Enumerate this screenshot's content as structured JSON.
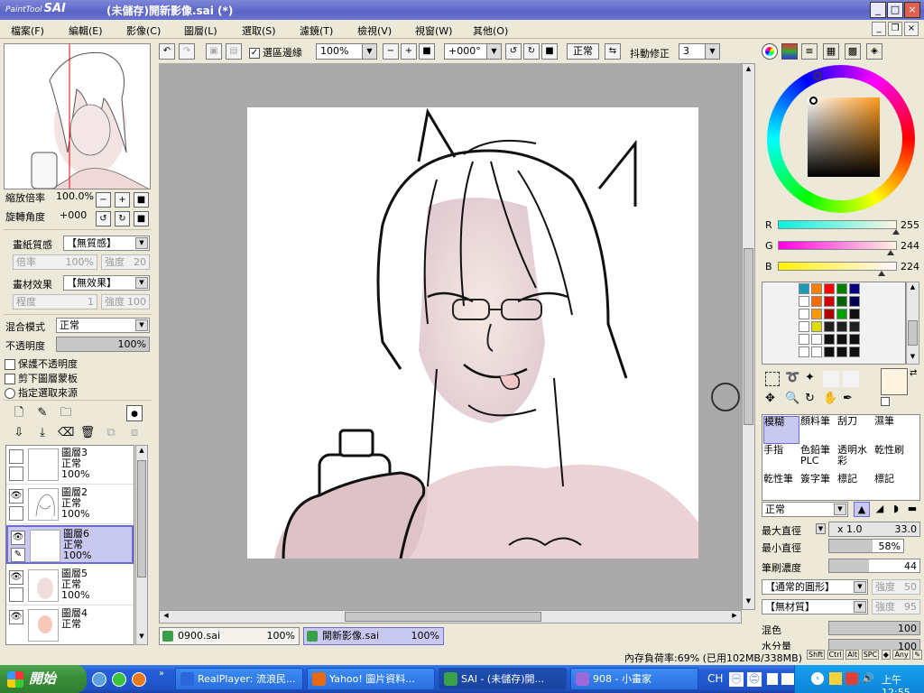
{
  "window": {
    "app_logo_small": "PaintTool",
    "app_logo_big": "SAI",
    "title": "(未儲存)開新影像.sai (*)",
    "min": "_",
    "max": "□",
    "close": "×"
  },
  "menu": [
    "檔案(F)",
    "編輯(E)",
    "影像(C)",
    "圖層(L)",
    "選取(S)",
    "濾鏡(T)",
    "檢視(V)",
    "視窗(W)",
    "其他(O)"
  ],
  "toolbar": {
    "show_selection_label": "選區邊緣",
    "show_selection_checked": true,
    "zoom": "100%",
    "rotation": "+000°",
    "blend_mode": "正常",
    "stabilizer_label": "抖動修正",
    "stabilizer_value": "3"
  },
  "navigator": {
    "zoom_label": "縮放倍率",
    "zoom_value": "100.0%",
    "rotate_label": "旋轉角度",
    "rotate_value": "+000"
  },
  "texture": {
    "paper_label": "畫紙質感",
    "paper_value": "【無質感】",
    "scale_label": "倍率",
    "scale_value": "100%",
    "strength_label": "強度",
    "strength_value": "20",
    "effect_label": "畫材效果",
    "effect_value": "【無效果】",
    "degree_label": "程度",
    "degree_value": "1",
    "effect_strength_label": "強度",
    "effect_strength_value": "100"
  },
  "layer_props": {
    "mode_label": "混合模式",
    "mode_value": "正常",
    "opacity_label": "不透明度",
    "opacity_value": "100%",
    "opacity": 1.0,
    "preserve_opacity": "保護不透明度",
    "clipping": "剪下圖層蒙板",
    "selection_source": "指定選取來源"
  },
  "layers": [
    {
      "name": "圖層3",
      "mode": "正常",
      "opacity": "100%",
      "visible": false,
      "selected": false
    },
    {
      "name": "圖層2",
      "mode": "正常",
      "opacity": "100%",
      "visible": true,
      "selected": false
    },
    {
      "name": "圖層6",
      "mode": "正常",
      "opacity": "100%",
      "visible": true,
      "selected": true
    },
    {
      "name": "圖層5",
      "mode": "正常",
      "opacity": "100%",
      "visible": true,
      "selected": false
    },
    {
      "name": "圖層4",
      "mode": "正常",
      "opacity": "",
      "visible": true,
      "selected": false
    }
  ],
  "color": {
    "current_hex": "#fff4e0",
    "r_label": "R",
    "r": 255,
    "g_label": "G",
    "g": 244,
    "b_label": "B",
    "b": 224,
    "swatches": [
      "#1e9bb4",
      "#ff8000",
      "#ff0000",
      "#008000",
      "#000080",
      "#ffffff",
      "#ff6a00",
      "#d10000",
      "#006400",
      "#000050",
      "#ffffff",
      "#ff9900",
      "#b00000",
      "#00a000",
      "#101010",
      "#ffffff",
      "#dddd00",
      "#202020",
      "#202020",
      "#202020",
      "#ffffff",
      "#ffffff",
      "#101010",
      "#101010",
      "#101010",
      "#ffffff",
      "#ffffff",
      "#101010",
      "#101010",
      "#101010"
    ]
  },
  "tools": [
    {
      "label": "模糊",
      "selected": true
    },
    {
      "label": "顏料筆",
      "selected": false
    },
    {
      "label": "刮刀",
      "selected": false
    },
    {
      "label": "濕筆",
      "selected": false
    },
    {
      "label": "手指",
      "selected": false
    },
    {
      "label": "色鉛筆PLC",
      "selected": false
    },
    {
      "label": "透明水彩",
      "selected": false
    },
    {
      "label": "乾性刷",
      "selected": false
    },
    {
      "label": "乾性筆",
      "selected": false
    },
    {
      "label": "簽字筆",
      "selected": false
    },
    {
      "label": "標記",
      "selected": false
    },
    {
      "label": "標記",
      "selected": false
    }
  ],
  "brush": {
    "mode": "正常",
    "max_size_label": "最大直徑",
    "max_mult": "x 1.0",
    "max_size": "33.0",
    "min_size_label": "最小直徑",
    "min_size": "58%",
    "min_size_fraction": 0.58,
    "density_label": "筆刷濃度",
    "density": "44",
    "density_fraction": 0.44,
    "shape": "【通常的圓形】",
    "shape_strength_label": "強度",
    "shape_strength": "50",
    "texture": "【無材質】",
    "texture_strength_label": "強度",
    "texture_strength": "95",
    "blend_label": "混色",
    "blend": "100",
    "water_label": "水分量",
    "water": "100"
  },
  "doc_tabs": [
    {
      "name": "0900.sai",
      "zoom": "100%",
      "active": false
    },
    {
      "name": "開新影像.sai",
      "zoom": "100%",
      "active": true
    }
  ],
  "status": {
    "memory": "內存負荷率:69% (已用102MB/338MB)",
    "keys": [
      "Shft",
      "Ctrl",
      "Alt",
      "SPC",
      "◆",
      "Any",
      "✎"
    ]
  },
  "taskbar": {
    "start": "開始",
    "tasks": [
      {
        "label": "RealPlayer: 流浪民...",
        "color": "#2a66d8",
        "active": false
      },
      {
        "label": "Yahoo! 圖片資料...",
        "color": "#e86a10",
        "active": false
      },
      {
        "label": "SAI - (未儲存)開...",
        "color": "#3aa04a",
        "active": true
      },
      {
        "label": "908 - 小畫家",
        "color": "#9c6ad8",
        "active": false
      }
    ],
    "lang": "CH",
    "clock": "上午 12:55"
  }
}
